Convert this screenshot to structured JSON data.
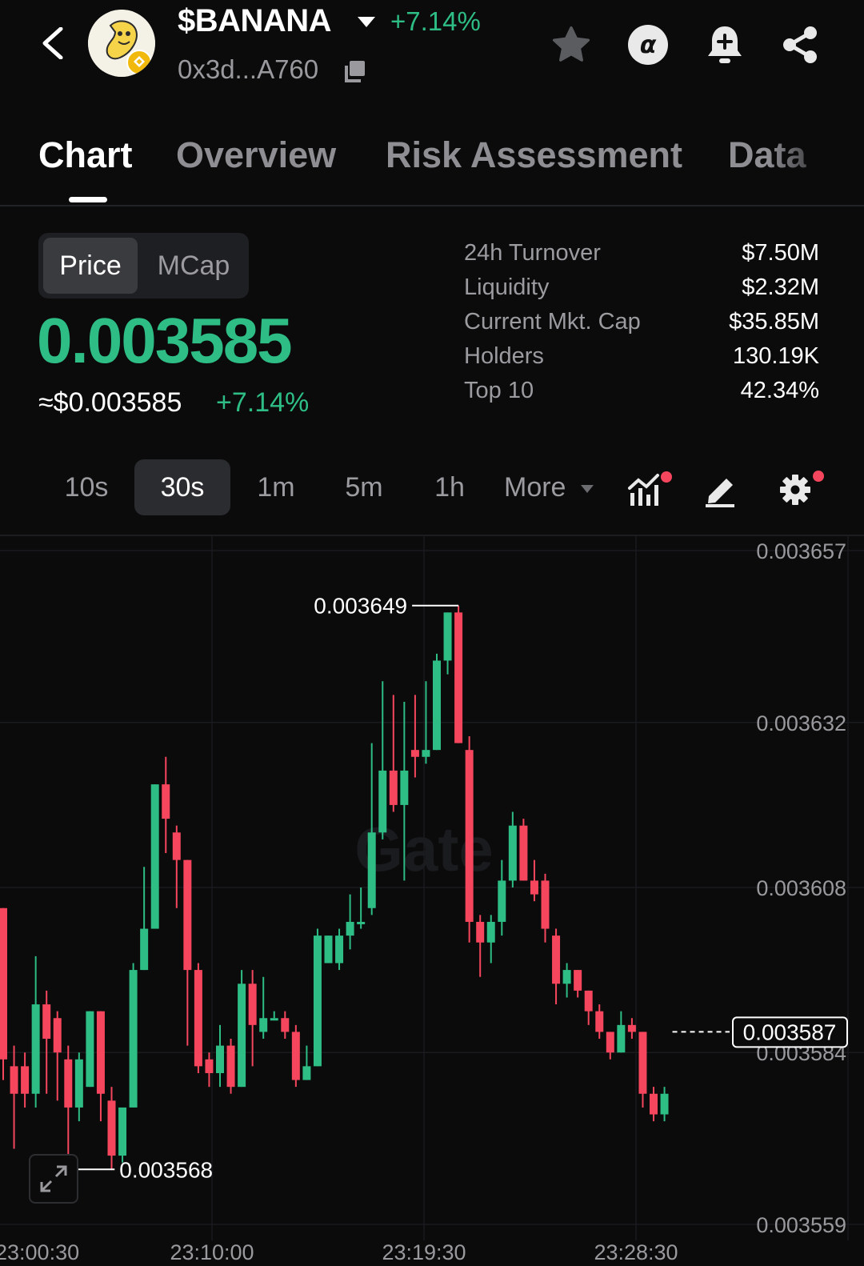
{
  "header": {
    "token_name": "$BANANA",
    "change": "+7.14%",
    "contract": "0x3d...A760",
    "icons": [
      "chevron-left-icon",
      "star-icon",
      "alpha-icon",
      "bell-plus-icon",
      "share-icon"
    ]
  },
  "tabs": [
    {
      "label": "Chart",
      "active": true
    },
    {
      "label": "Overview",
      "active": false
    },
    {
      "label": "Risk Assessment",
      "active": false
    },
    {
      "label": "Data",
      "active": false
    }
  ],
  "toggle": {
    "selected": "Price",
    "other": "MCap"
  },
  "price": {
    "value": "0.003585",
    "usd": "≈$0.003585",
    "change": "+7.14%"
  },
  "stats": [
    {
      "label": "24h Turnover",
      "value": "$7.50M"
    },
    {
      "label": "Liquidity",
      "value": "$2.32M"
    },
    {
      "label": "Current Mkt. Cap",
      "value": "$35.85M"
    },
    {
      "label": "Holders",
      "value": "130.19K"
    },
    {
      "label": "Top 10",
      "value": "42.34%"
    }
  ],
  "intervals": [
    "10s",
    "30s",
    "1m",
    "5m",
    "1h",
    "More"
  ],
  "selected_interval": "30s",
  "colors": {
    "up": "#2dbd85",
    "down": "#f6465d",
    "background": "#0b0b0c"
  },
  "chart_data": {
    "type": "candlestick",
    "y_ticks": [
      "0.003657",
      "0.003632",
      "0.003608",
      "0.003584",
      "0.003559"
    ],
    "x_ticks": [
      "23:00:30",
      "23:10:00",
      "23:19:30",
      "23:28:30"
    ],
    "ylim": [
      0.003559,
      0.003657
    ],
    "high_label": "0.003649",
    "low_label": "0.003568",
    "last_price_label": "0.003587",
    "watermark": "Gate",
    "candles": [
      {
        "o": 0.003605,
        "c": 0.003583,
        "h": 0.003605,
        "l": 0.00358
      },
      {
        "o": 0.003582,
        "c": 0.003578,
        "h": 0.003585,
        "l": 0.00357
      },
      {
        "o": 0.003582,
        "c": 0.003578,
        "h": 0.003584,
        "l": 0.003576
      },
      {
        "o": 0.003578,
        "c": 0.003591,
        "h": 0.003598,
        "l": 0.003576
      },
      {
        "o": 0.003591,
        "c": 0.003586,
        "h": 0.003593,
        "l": 0.003578
      },
      {
        "o": 0.003589,
        "c": 0.003584,
        "h": 0.00359,
        "l": 0.003577
      },
      {
        "o": 0.003583,
        "c": 0.003576,
        "h": 0.003585,
        "l": 0.003567
      },
      {
        "o": 0.003576,
        "c": 0.003583,
        "h": 0.003584,
        "l": 0.003574
      },
      {
        "o": 0.003579,
        "c": 0.00359,
        "h": 0.00359,
        "l": 0.003579
      },
      {
        "o": 0.00359,
        "c": 0.003578,
        "h": 0.00359,
        "l": 0.003574
      },
      {
        "o": 0.003577,
        "c": 0.003569,
        "h": 0.003579,
        "l": 0.003567
      },
      {
        "o": 0.003569,
        "c": 0.003576,
        "h": 0.003576,
        "l": 0.003568
      },
      {
        "o": 0.003576,
        "c": 0.003596,
        "h": 0.003597,
        "l": 0.003576
      },
      {
        "o": 0.003596,
        "c": 0.003602,
        "h": 0.003611,
        "l": 0.003596
      },
      {
        "o": 0.003602,
        "c": 0.003623,
        "h": 0.003623,
        "l": 0.003602
      },
      {
        "o": 0.003623,
        "c": 0.003618,
        "h": 0.003627,
        "l": 0.003613
      },
      {
        "o": 0.003616,
        "c": 0.003612,
        "h": 0.003617,
        "l": 0.003605
      },
      {
        "o": 0.003612,
        "c": 0.003596,
        "h": 0.003612,
        "l": 0.003585
      },
      {
        "o": 0.003596,
        "c": 0.003582,
        "h": 0.003597,
        "l": 0.003581
      },
      {
        "o": 0.003583,
        "c": 0.003581,
        "h": 0.003584,
        "l": 0.003579
      },
      {
        "o": 0.003581,
        "c": 0.003585,
        "h": 0.003588,
        "l": 0.003579
      },
      {
        "o": 0.003585,
        "c": 0.003579,
        "h": 0.003586,
        "l": 0.003578
      },
      {
        "o": 0.003579,
        "c": 0.003594,
        "h": 0.003596,
        "l": 0.003579
      },
      {
        "o": 0.003594,
        "c": 0.003588,
        "h": 0.003596,
        "l": 0.003582
      },
      {
        "o": 0.003587,
        "c": 0.003589,
        "h": 0.003595,
        "l": 0.003586
      },
      {
        "o": 0.003589,
        "c": 0.003589,
        "h": 0.00359,
        "l": 0.003589
      },
      {
        "o": 0.003589,
        "c": 0.003587,
        "h": 0.00359,
        "l": 0.003586
      },
      {
        "o": 0.003587,
        "c": 0.00358,
        "h": 0.003588,
        "l": 0.003579
      },
      {
        "o": 0.00358,
        "c": 0.003582,
        "h": 0.003585,
        "l": 0.00358
      },
      {
        "o": 0.003582,
        "c": 0.003601,
        "h": 0.003602,
        "l": 0.003582
      },
      {
        "o": 0.003597,
        "c": 0.003601,
        "h": 0.003601,
        "l": 0.003597
      },
      {
        "o": 0.003597,
        "c": 0.003601,
        "h": 0.003602,
        "l": 0.003596
      },
      {
        "o": 0.003601,
        "c": 0.003603,
        "h": 0.003607,
        "l": 0.003599
      },
      {
        "o": 0.003603,
        "c": 0.003603,
        "h": 0.003608,
        "l": 0.003602
      },
      {
        "o": 0.003605,
        "c": 0.003616,
        "h": 0.003629,
        "l": 0.003604
      },
      {
        "o": 0.003616,
        "c": 0.003625,
        "h": 0.003638,
        "l": 0.003615
      },
      {
        "o": 0.003625,
        "c": 0.00362,
        "h": 0.003636,
        "l": 0.003619
      },
      {
        "o": 0.00362,
        "c": 0.003625,
        "h": 0.003635,
        "l": 0.003609
      },
      {
        "o": 0.003628,
        "c": 0.003627,
        "h": 0.003636,
        "l": 0.003624
      },
      {
        "o": 0.003627,
        "c": 0.003628,
        "h": 0.003638,
        "l": 0.003626
      },
      {
        "o": 0.003628,
        "c": 0.003641,
        "h": 0.003642,
        "l": 0.003628
      },
      {
        "o": 0.003641,
        "c": 0.003648,
        "h": 0.003648,
        "l": 0.003639
      },
      {
        "o": 0.003648,
        "c": 0.003629,
        "h": 0.003649,
        "l": 0.003629
      },
      {
        "o": 0.003628,
        "c": 0.003603,
        "h": 0.00363,
        "l": 0.0036
      },
      {
        "o": 0.003603,
        "c": 0.0036,
        "h": 0.003604,
        "l": 0.003595
      },
      {
        "o": 0.0036,
        "c": 0.003603,
        "h": 0.003604,
        "l": 0.003597
      },
      {
        "o": 0.003603,
        "c": 0.003609,
        "h": 0.003612,
        "l": 0.003601
      },
      {
        "o": 0.003609,
        "c": 0.003617,
        "h": 0.003619,
        "l": 0.003608
      },
      {
        "o": 0.003617,
        "c": 0.003609,
        "h": 0.003618,
        "l": 0.003609
      },
      {
        "o": 0.003609,
        "c": 0.003607,
        "h": 0.003612,
        "l": 0.003606
      },
      {
        "o": 0.003609,
        "c": 0.003602,
        "h": 0.00361,
        "l": 0.0036
      },
      {
        "o": 0.003601,
        "c": 0.003594,
        "h": 0.003602,
        "l": 0.003591
      },
      {
        "o": 0.003594,
        "c": 0.003596,
        "h": 0.003597,
        "l": 0.003592
      },
      {
        "o": 0.003596,
        "c": 0.003593,
        "h": 0.003596,
        "l": 0.003592
      },
      {
        "o": 0.003593,
        "c": 0.00359,
        "h": 0.003593,
        "l": 0.003588
      },
      {
        "o": 0.00359,
        "c": 0.003587,
        "h": 0.003591,
        "l": 0.003586
      },
      {
        "o": 0.003587,
        "c": 0.003584,
        "h": 0.003587,
        "l": 0.003583
      },
      {
        "o": 0.003584,
        "c": 0.003588,
        "h": 0.00359,
        "l": 0.003584
      },
      {
        "o": 0.003588,
        "c": 0.003587,
        "h": 0.003589,
        "l": 0.003586
      },
      {
        "o": 0.003587,
        "c": 0.003578,
        "h": 0.003587,
        "l": 0.003576
      },
      {
        "o": 0.003578,
        "c": 0.003575,
        "h": 0.003579,
        "l": 0.003574
      },
      {
        "o": 0.003575,
        "c": 0.003578,
        "h": 0.003579,
        "l": 0.003574
      }
    ]
  }
}
